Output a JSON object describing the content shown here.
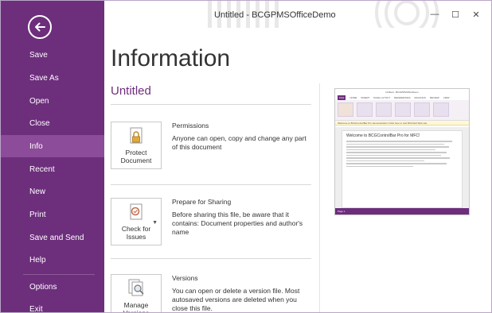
{
  "window": {
    "title": "Untitled - BCGPMSOfficeDemo",
    "minimize_glyph": "—",
    "maximize_glyph": "☐",
    "close_glyph": "✕"
  },
  "sidebar": {
    "back_icon": "back-arrow-icon",
    "items": [
      {
        "label": "Save"
      },
      {
        "label": "Save As"
      },
      {
        "label": "Open"
      },
      {
        "label": "Close"
      },
      {
        "label": "Info",
        "active": true
      },
      {
        "label": "Recent"
      },
      {
        "label": "New"
      },
      {
        "label": "Print"
      },
      {
        "label": "Save and Send"
      },
      {
        "label": "Help"
      },
      {
        "label": "Options"
      },
      {
        "label": "Exit"
      }
    ]
  },
  "main": {
    "title": "Information",
    "document_name": "Untitled",
    "sections": [
      {
        "button_label": "Protect Document",
        "icon": "lock-icon",
        "title": "Permissions",
        "description": "Anyone can open, copy and change any part of this document"
      },
      {
        "button_label": "Check for Issues",
        "icon": "check-document-icon",
        "title": "Prepare for Sharing",
        "description": "Before sharing this file, be aware that it contains: Document properties and  author's name"
      },
      {
        "button_label": "Manage Versions",
        "icon": "manage-versions-icon",
        "title": "Versions",
        "description": "You can open or delete a version file. Most autosaved versions are deleted when you close this file."
      }
    ]
  },
  "preview": {
    "title": "Untitled - BCGPMSOfficeDemo",
    "tabs": [
      "FILE",
      "HOME",
      "INSERT",
      "PAGE LAYOUT",
      "REFERENCES",
      "MAILINGS",
      "REVIEW",
      "VIEW"
    ],
    "message_bar": "Welcome to BCGControlBar Pro demonstration! Click here to visit BCGSoft Web site.",
    "heading": "Welcome to BCGControlBar Pro for MFC!",
    "status": "Page 1"
  },
  "colors": {
    "accent": "#6d2e7c",
    "active_nav": "#8c4c99",
    "doc_name": "#6d2e7c"
  }
}
